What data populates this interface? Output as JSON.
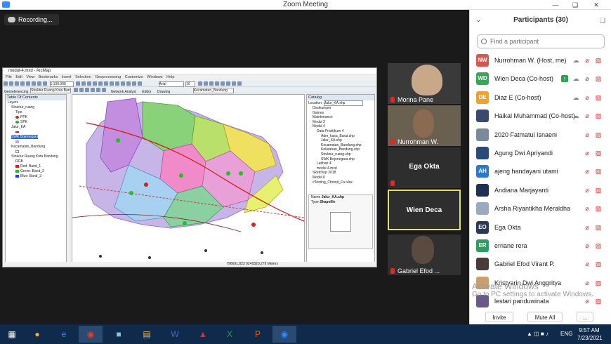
{
  "window": {
    "title": "Zoom Meeting"
  },
  "recording": {
    "label": "Recording..."
  },
  "arcmap": {
    "title": "modul-4.mxd - ArcMap",
    "menu": "File Edit View Bookmarks Insert Selection Geoprocessing Customize Windows Help",
    "scale": "1:100.000",
    "font": "Arial",
    "font_size": "10",
    "drawing": "Drawing",
    "editor": "Editor",
    "georef": "Georeferencing",
    "georef_layer": "Struktur Ruang Kota Bandung.jpg",
    "network": "Network Analyst",
    "layer_dropdown": "Kecamatan_Bandung",
    "toc": {
      "title": "Table Of Contents",
      "rows": [
        "Layers",
        "Struktur_ruang",
        "Tipe",
        "PPK",
        "SPK",
        "Jalur_KA",
        "SWK Bojonegara",
        "Kecamatan_Bandung",
        "Struktur Ruang Kota Bandung",
        "RGB",
        "Red: Band_1",
        "Green: Band_2",
        "Blue: Band_3"
      ]
    },
    "catalog": {
      "title": "Catalog",
      "location": "Jalur_KA.shp",
      "rows": [
        "Dosikumper",
        "Games",
        "Maintenance",
        "Modul 3",
        "Modul 4",
        "Data Praktikum 4",
        "Adm_kasa_Barat.shp",
        "Jalur_KA.shp",
        "Kecamatan_Bandung.shp",
        "Kelurahan_Bandung.shp",
        "Struktur_ruang.shp",
        "SWK Bojonegara.shp",
        "Latihan 4",
        "modul 4.mxd",
        "Sketchup 2018",
        "Modul 6",
        "#Testing_Cfonnit_Fix.xlsx"
      ],
      "preview_name": "Jalur_KA.shp",
      "preview_type": "Shapefile"
    },
    "status_coords": "796691,823 9241820,279 Meters"
  },
  "tiles": [
    {
      "name": "Morina Pane"
    },
    {
      "name": "Nurrohman W."
    },
    {
      "name": "Ega Okta"
    },
    {
      "name": "Wien Deca"
    },
    {
      "name": "Gabriel Efod ..."
    }
  ],
  "panel": {
    "title": "Participants (30)",
    "search_placeholder": "Find a participant",
    "participants": [
      {
        "initials": "NW",
        "color": "#d9534f",
        "name": "Nurrohman W. (Host, me)"
      },
      {
        "initials": "WD",
        "color": "#3aa655",
        "name": "Wien Deca (Co-host)"
      },
      {
        "initials": "DE",
        "color": "#f0a030",
        "name": "Diaz E (Co-host)"
      },
      {
        "initials": "",
        "color": "#3a4a6a",
        "name": "Haikal Muhammad (Co-host)"
      },
      {
        "initials": "",
        "color": "#7a8a9a",
        "name": "2020 Fatmatul Isnaeni"
      },
      {
        "initials": "",
        "color": "#2a4a7a",
        "name": "Agung Dwi Apriyandi"
      },
      {
        "initials": "AH",
        "color": "#2d78c8",
        "name": "ajeng handayani utami"
      },
      {
        "initials": "",
        "color": "#203050",
        "name": "Andiana Marjayanti"
      },
      {
        "initials": "",
        "color": "#9aa8c0",
        "name": "Arsha Riyantikha Meraldha"
      },
      {
        "initials": "EO",
        "color": "#2a3a55",
        "name": "Ega Okta"
      },
      {
        "initials": "ER",
        "color": "#2aa060",
        "name": "erriane rera"
      },
      {
        "initials": "",
        "color": "#4a3a3a",
        "name": "Gabriel Efod Virant P."
      },
      {
        "initials": "",
        "color": "#c8a070",
        "name": "Kristyarin Dwi Anggritya"
      },
      {
        "initials": "",
        "color": "#6a5a8a",
        "name": "lestari panduwinata"
      }
    ],
    "invite": "Invite",
    "mute_all": "Mute All",
    "more": "..."
  },
  "watermark": {
    "line1": "Activate Windows",
    "line2": "Go to PC settings to activate Windows."
  },
  "taskbar": {
    "lang": "ENG",
    "time": "9:57 AM",
    "date": "7/23/2021"
  }
}
